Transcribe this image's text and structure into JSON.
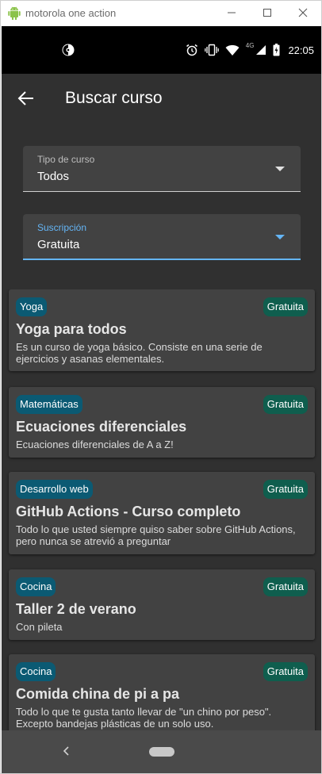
{
  "window": {
    "title": "motorola one action"
  },
  "statusbar": {
    "network": "4G",
    "time": "22:05"
  },
  "appbar": {
    "title": "Buscar curso"
  },
  "filters": {
    "tipo": {
      "label": "Tipo de curso",
      "value": "Todos"
    },
    "suscripcion": {
      "label": "Suscripción",
      "value": "Gratuita"
    }
  },
  "courses": [
    {
      "category": "Yoga",
      "price": "Gratuita",
      "title": "Yoga para todos",
      "description": "Es un curso de yoga básico. Consiste en una serie de ejercicios y asanas elementales."
    },
    {
      "category": "Matemáticas",
      "price": "Gratuita",
      "title": "Ecuaciones diferenciales",
      "description": "Ecuaciones diferenciales de A a Z!"
    },
    {
      "category": "Desarrollo web",
      "price": "Gratuita",
      "title": "GitHub Actions - Curso completo",
      "description": "Todo lo que usted siempre quiso saber sobre GitHub Actions, pero nunca se atrevió a preguntar"
    },
    {
      "category": "Cocina",
      "price": "Gratuita",
      "title": "Taller 2 de verano",
      "description": "Con pileta"
    },
    {
      "category": "Cocina",
      "price": "Gratuita",
      "title": "Comida china de pi a pa",
      "description": "Todo lo que te gusta tanto llevar de \"un chino por peso\". Excepto bandejas plásticas de un solo uso."
    }
  ],
  "colors": {
    "background": "#303030",
    "card": "#424242",
    "category_chip": "#0b5a73",
    "price_chip": "#0f5e4e",
    "accent": "#64b5f6"
  },
  "icons": {
    "window": [
      "android-icon",
      "minimize-icon",
      "maximize-icon",
      "close-icon"
    ],
    "status": [
      "app-status-icon",
      "alarm-icon",
      "vibrate-icon",
      "wifi-icon",
      "signal-icon",
      "battery-icon"
    ],
    "app": [
      "back-arrow-icon",
      "dropdown-caret-icon"
    ],
    "nav": [
      "nav-back-icon",
      "nav-home-pill"
    ]
  }
}
